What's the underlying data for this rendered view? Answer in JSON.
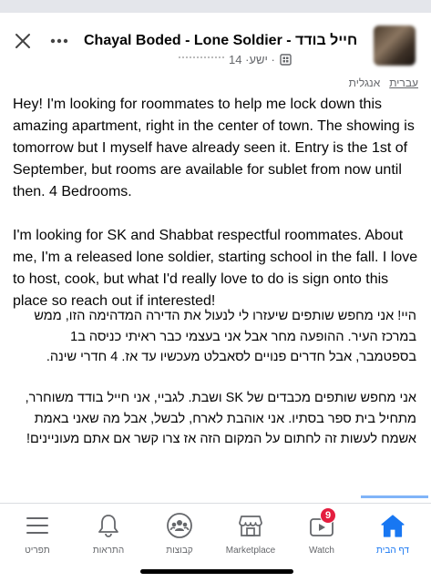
{
  "header": {
    "title": "Chayal Boded - Lone Soldier - חייל בודד",
    "meta_date": "14 ·ישע · ",
    "translate_options": [
      "אנגלית",
      "עברית"
    ]
  },
  "post": {
    "english_text": "Hey! I'm looking for roommates to help me lock down this amazing apartment, right in the center of town. The showing is tomorrow but I myself have already seen it. Entry is the 1st of September, but rooms are available for sublet from now until then. 4 Bedrooms.\n\nI'm looking for SK and Shabbat respectful roommates. About me, I'm a released lone soldier, starting school in the fall. I love to host, cook, but what I'd really love to do is sign onto this place so reach out if interested!",
    "hebrew_text": "היי! אני מחפש שותפים שיעזרו לי לנעול את הדירה המדהימה הזו, ממש במרכז העיר. ההופעה מחר אבל אני בעצמי כבר ראיתי כניסה ב1 בספטמבר, אבל חדרים פנויים לסאבלט מעכשיו עד אז. 4 חדרי שינה.\n\nאני מחפש שותפים מכבדים של SK ושבת. לגביי, אני חייל בודד משוחרר, מתחיל בית ספר בסתיו. אני אוהבת לארח, לבשל, אבל מה שאני באמת אשמח לעשות זה לחתום על המקום הזה אז צרו קשר אם אתם מעוניינים!"
  },
  "bottom_nav": {
    "items": [
      {
        "label": "תפריט",
        "icon": "menu-icon"
      },
      {
        "label": "התראות",
        "icon": "bell-icon"
      },
      {
        "label": "קבוצות",
        "icon": "groups-icon"
      },
      {
        "label": "Marketplace",
        "icon": "marketplace-icon"
      },
      {
        "label": "Watch",
        "icon": "watch-icon",
        "badge": "9"
      },
      {
        "label": "דף הבית",
        "icon": "home-icon",
        "active": true
      }
    ]
  },
  "colors": {
    "accent": "#1877f2",
    "badge": "#e41e3f",
    "secondary_text": "#65676b"
  }
}
